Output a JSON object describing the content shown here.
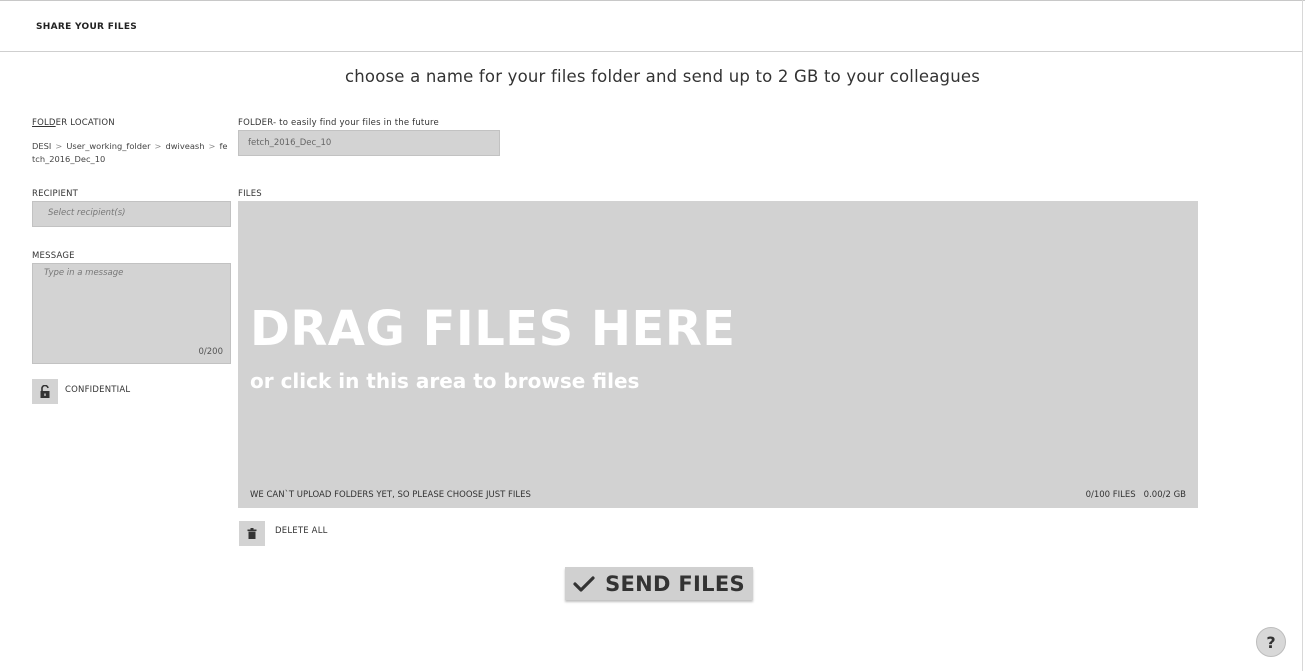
{
  "header": {
    "title": "SHARE YOUR FILES"
  },
  "subtitle": "choose a name for your files folder and send up to 2 GB to your colleagues",
  "folder_location": {
    "label_underlined": "FOLD",
    "label_rest": "ER LOCATION",
    "path": [
      "DESI",
      "User_working_folder",
      "dwiveash",
      "fetch_2016_Dec_10"
    ]
  },
  "folder": {
    "label": "FOLDER- to easily find your files in the future",
    "value": "fetch_2016_Dec_10"
  },
  "recipient": {
    "label": "RECIPIENT",
    "placeholder": "Select recipient(s)"
  },
  "message": {
    "label": "MESSAGE",
    "placeholder": "Type in a message",
    "counter": "0/200"
  },
  "confidential": {
    "label": "CONFIDENTIAL",
    "icon": "unlock-icon"
  },
  "files": {
    "label": "FILES",
    "drag_title": "DRAG FILES HERE",
    "drag_subtitle": "or click in this area to browse files",
    "note": "WE CAN`T UPLOAD FOLDERS YET, SO PLEASE CHOOSE JUST FILES",
    "file_count": "0/100 FILES",
    "size_count": "0.00/2 GB"
  },
  "delete_all": {
    "label": "DELETE ALL",
    "icon": "trash-icon"
  },
  "send": {
    "label": "SEND FILES",
    "icon": "check-icon"
  },
  "help": {
    "label": "?"
  }
}
